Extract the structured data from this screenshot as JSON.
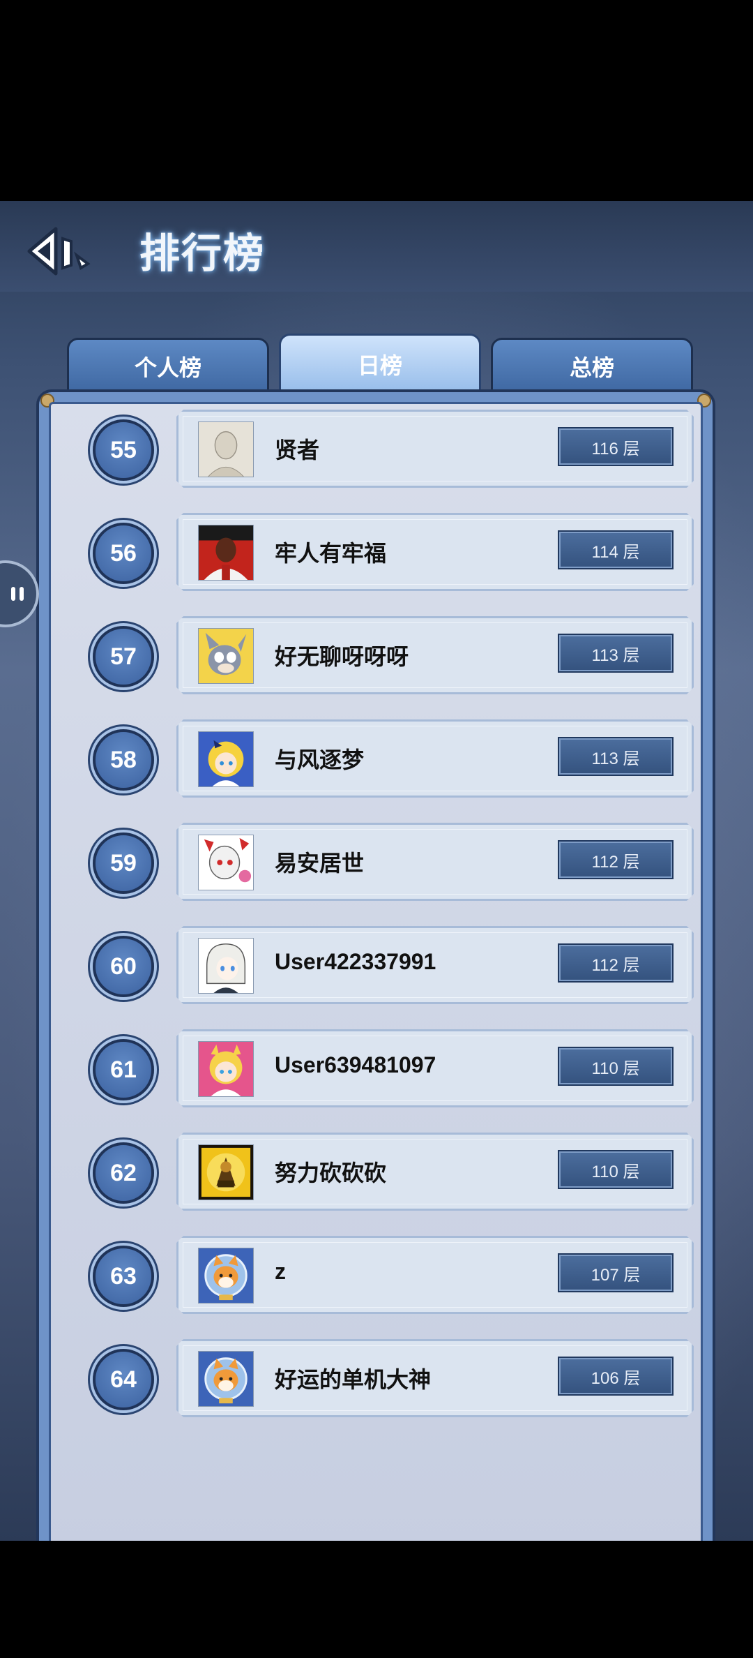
{
  "header": {
    "title": "排行榜"
  },
  "tabs": [
    {
      "label": "个人榜",
      "active": false
    },
    {
      "label": "日榜",
      "active": true
    },
    {
      "label": "总榜",
      "active": false
    }
  ],
  "colors": {
    "accent": "#4a6fa5",
    "active_tab": "#a8c8f0"
  },
  "leaderboard": [
    {
      "rank": "55",
      "name": "贤者",
      "score": "116 层",
      "avatar_icon": "sketch-portrait"
    },
    {
      "rank": "56",
      "name": "牢人有牢福",
      "score": "114 层",
      "avatar_icon": "man-portrait-red"
    },
    {
      "rank": "57",
      "name": "好无聊呀呀呀",
      "score": "113 层",
      "avatar_icon": "cartoon-cat"
    },
    {
      "rank": "58",
      "name": "与风逐梦",
      "score": "113 层",
      "avatar_icon": "anime-girl-blonde"
    },
    {
      "rank": "59",
      "name": "易安居世",
      "score": "112 层",
      "avatar_icon": "anime-girl-white-red"
    },
    {
      "rank": "60",
      "name": "User422337991",
      "score": "112 层",
      "avatar_icon": "anime-girl-white"
    },
    {
      "rank": "61",
      "name": "User639481097",
      "score": "110 层",
      "avatar_icon": "anime-girl-pink"
    },
    {
      "rank": "62",
      "name": "努力砍砍砍",
      "score": "110 层",
      "avatar_icon": "gold-warrior-badge"
    },
    {
      "rank": "63",
      "name": "z",
      "score": "107 层",
      "avatar_icon": "shiba-astronaut"
    },
    {
      "rank": "64",
      "name": "好运的单机大神",
      "score": "106 层",
      "avatar_icon": "shiba-astronaut"
    }
  ]
}
